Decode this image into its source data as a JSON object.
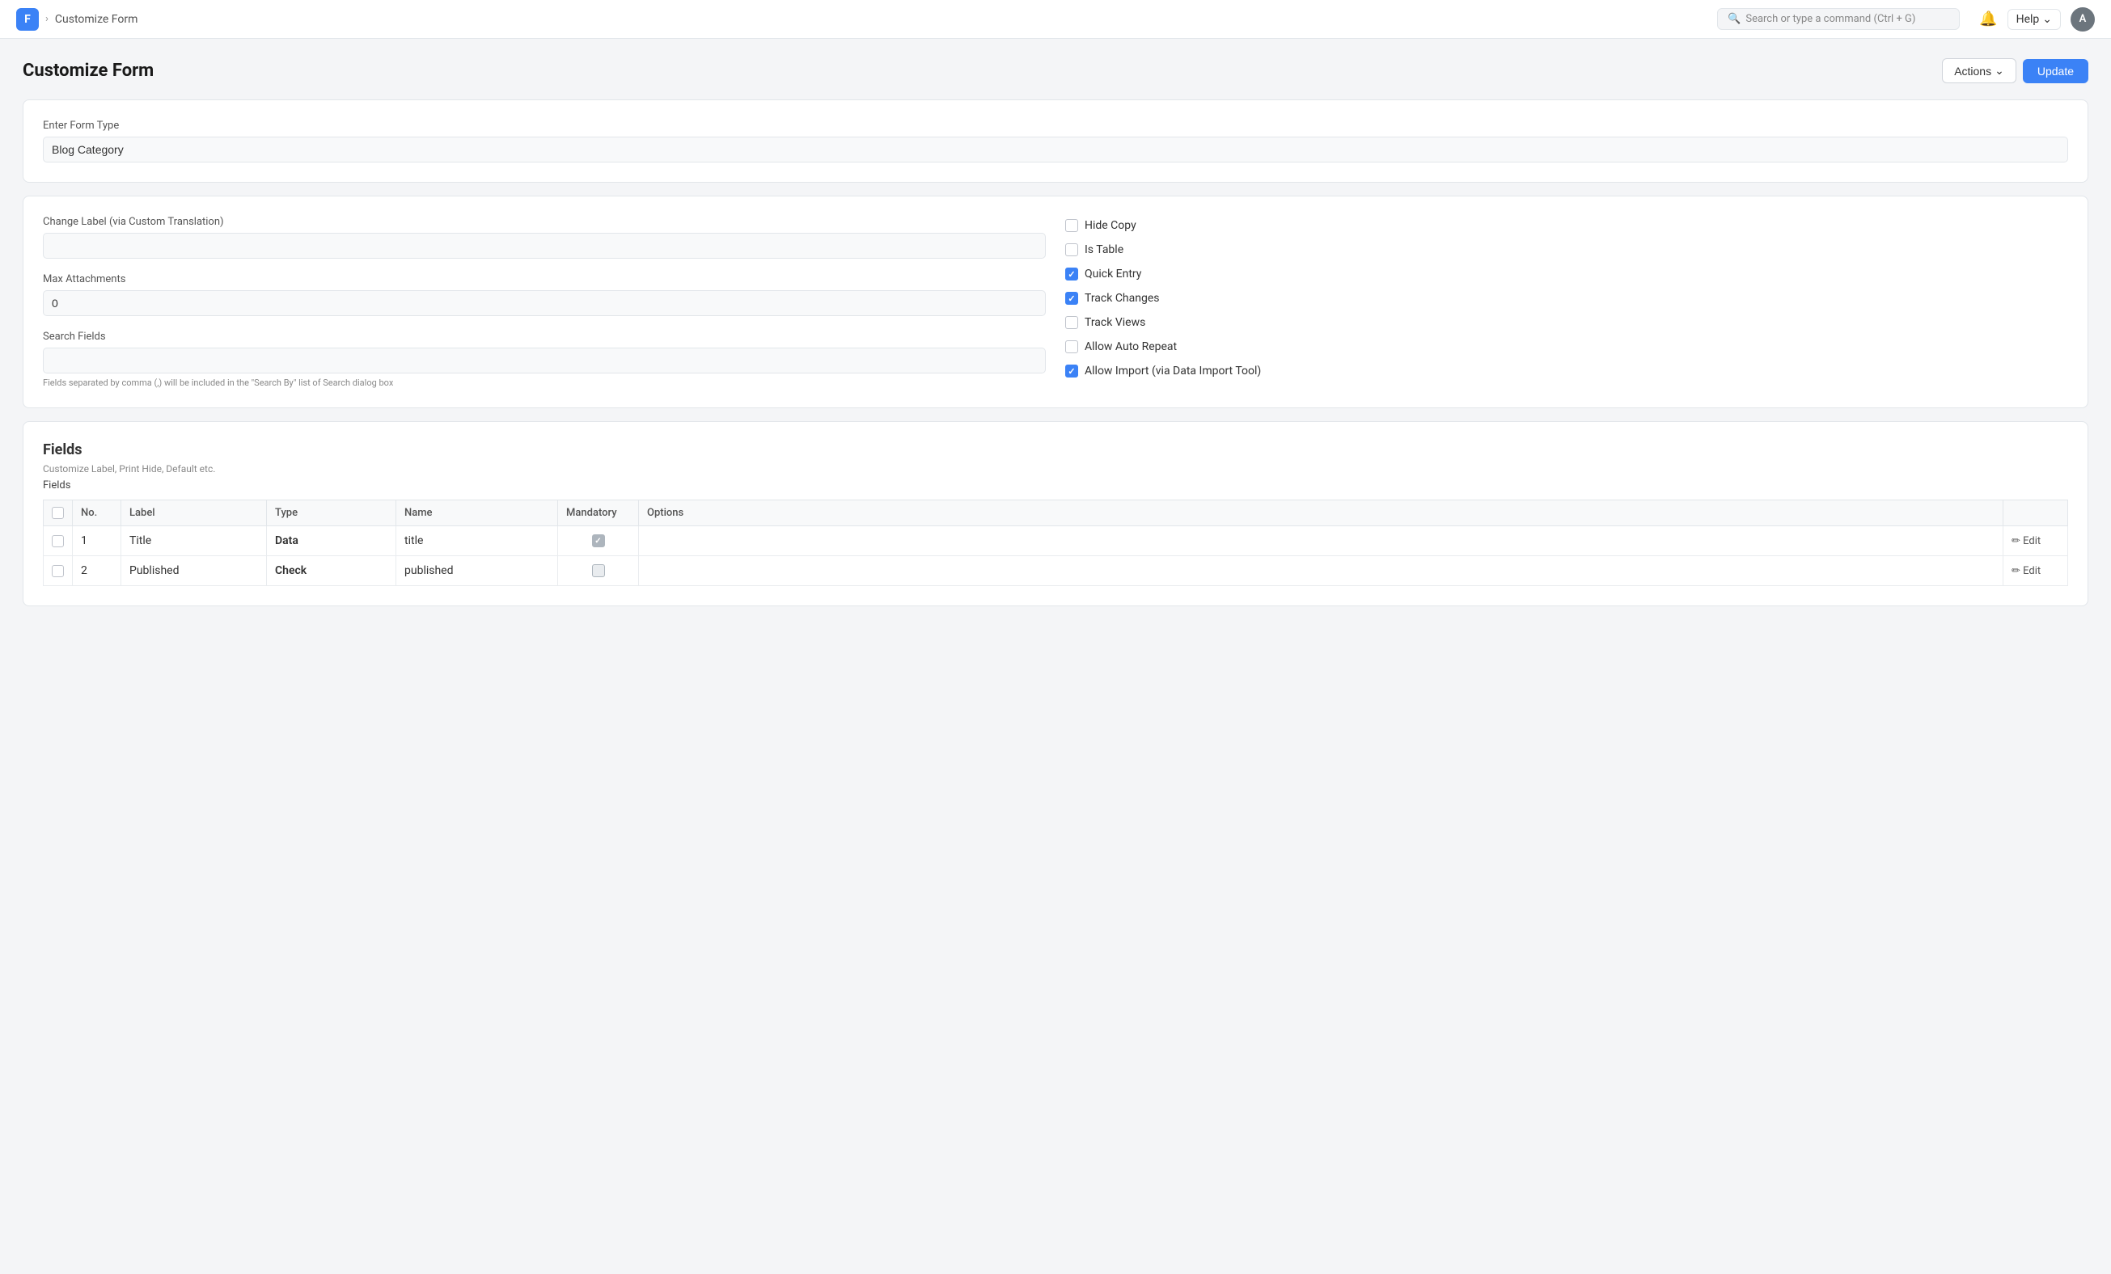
{
  "topbar": {
    "logo": "F",
    "breadcrumb_separator": "›",
    "breadcrumb": "Customize Form",
    "search_placeholder": "Search or type a command (Ctrl + G)",
    "help_label": "Help",
    "help_chevron": "⌄",
    "avatar_label": "A"
  },
  "page": {
    "title": "Customize Form",
    "actions_button": "Actions",
    "actions_chevron": "⌃⌄",
    "update_button": "Update"
  },
  "form_type_section": {
    "label": "Enter Form Type",
    "value": "Blog Category"
  },
  "settings_section": {
    "change_label_label": "Change Label (via Custom Translation)",
    "change_label_value": "",
    "max_attachments_label": "Max Attachments",
    "max_attachments_value": "0",
    "search_fields_label": "Search Fields",
    "search_fields_value": "",
    "search_fields_hint": "Fields separated by comma (,) will be included in the \"Search By\" list of Search dialog box",
    "checkboxes": [
      {
        "id": "hide_copy",
        "label": "Hide Copy",
        "checked": false
      },
      {
        "id": "is_table",
        "label": "Is Table",
        "checked": false
      },
      {
        "id": "quick_entry",
        "label": "Quick Entry",
        "checked": true
      },
      {
        "id": "track_changes",
        "label": "Track Changes",
        "checked": true
      },
      {
        "id": "track_views",
        "label": "Track Views",
        "checked": false
      },
      {
        "id": "allow_auto_repeat",
        "label": "Allow Auto Repeat",
        "checked": false
      },
      {
        "id": "allow_import",
        "label": "Allow Import (via Data Import Tool)",
        "checked": true
      }
    ]
  },
  "fields_section": {
    "title": "Fields",
    "description": "Customize Label, Print Hide, Default etc.",
    "label": "Fields",
    "table": {
      "columns": [
        "",
        "No.",
        "Label",
        "Type",
        "Name",
        "Mandatory",
        "Options",
        ""
      ],
      "rows": [
        {
          "no": "1",
          "label": "Title",
          "type": "Data",
          "name": "title",
          "mandatory": true,
          "options": "",
          "edit": "Edit"
        },
        {
          "no": "2",
          "label": "Published",
          "type": "Check",
          "name": "published",
          "mandatory": false,
          "options": "",
          "edit": "Edit"
        }
      ]
    }
  }
}
